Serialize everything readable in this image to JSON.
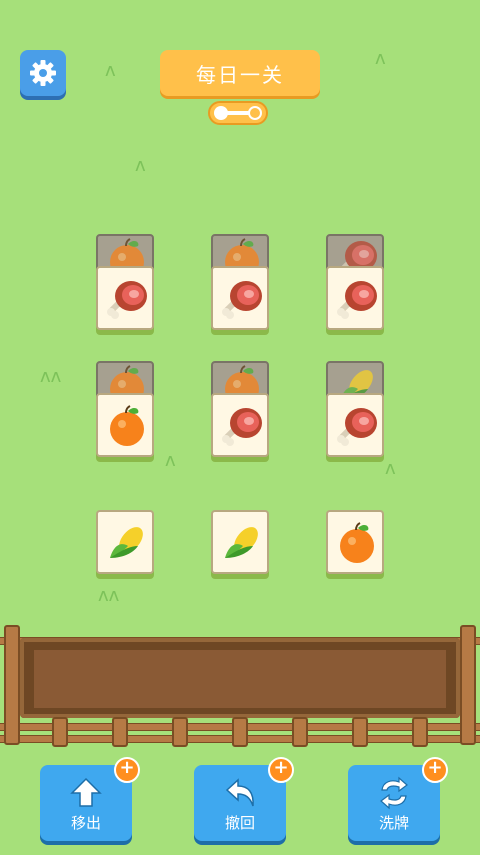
{
  "header": {
    "title": "每日一关"
  },
  "board": {
    "tiles": [
      {
        "col": 0,
        "row": 0,
        "under": "orange",
        "top": "ham"
      },
      {
        "col": 1,
        "row": 0,
        "under": "orange",
        "top": "ham"
      },
      {
        "col": 2,
        "row": 0,
        "under": "ham",
        "top": "ham"
      },
      {
        "col": 0,
        "row": 1,
        "under": "orange",
        "top": "orange"
      },
      {
        "col": 1,
        "row": 1,
        "under": "orange",
        "top": "ham"
      },
      {
        "col": 2,
        "row": 1,
        "under": "corn",
        "top": "ham"
      },
      {
        "col": 0,
        "row": 2,
        "under": null,
        "top": "corn"
      },
      {
        "col": 1,
        "row": 2,
        "under": null,
        "top": "corn"
      },
      {
        "col": 2,
        "row": 2,
        "under": null,
        "top": "orange"
      }
    ]
  },
  "buttons": {
    "remove": "移出",
    "undo": "撤回",
    "shuffle": "洗牌"
  },
  "colors": {
    "accent": "#ffc04a",
    "button": "#3fa8ef",
    "plus": "#ff8f1f"
  }
}
